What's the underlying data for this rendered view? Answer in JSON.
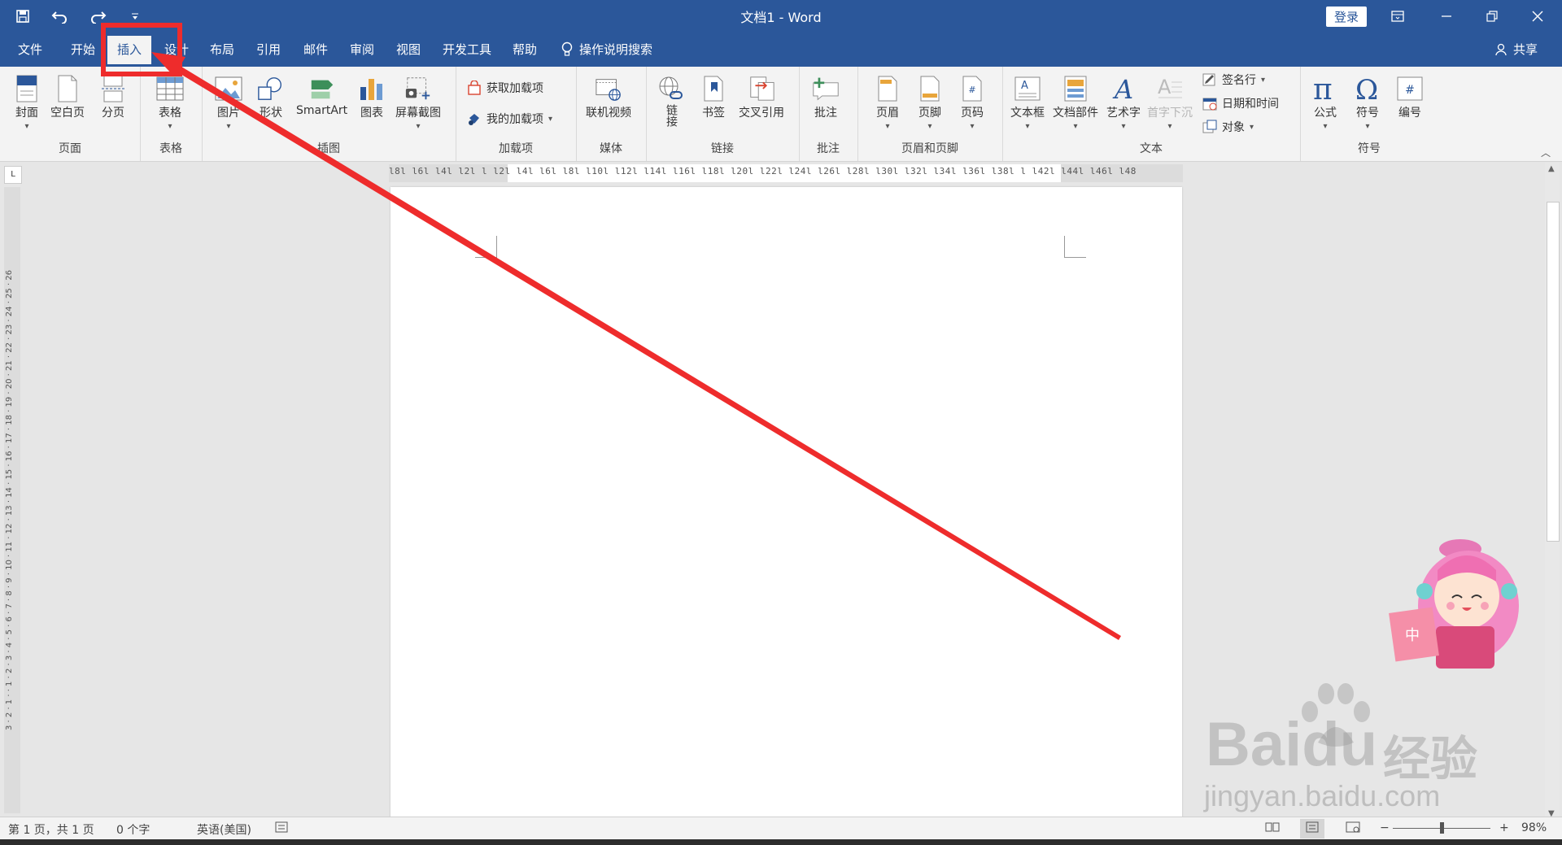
{
  "titlebar": {
    "title": "文档1  -  Word",
    "login": "登录"
  },
  "tabs": [
    "文件",
    "开始",
    "插入",
    "设计",
    "布局",
    "引用",
    "邮件",
    "审阅",
    "视图",
    "开发工具",
    "帮助"
  ],
  "active_tab": "插入",
  "tellme": "操作说明搜索",
  "share": "共享",
  "ribbon": {
    "pages": {
      "cover": "封面",
      "blank": "空白页",
      "break": "分页",
      "label": "页面"
    },
    "tables": {
      "table": "表格",
      "label": "表格"
    },
    "illustrations": {
      "picture": "图片",
      "shapes": "形状",
      "smartart": "SmartArt",
      "chart": "图表",
      "screenshot": "屏幕截图",
      "label": "插图"
    },
    "addins": {
      "get": "获取加载项",
      "mine": "我的加载项",
      "label": "加载项"
    },
    "media": {
      "video": "联机视频",
      "label": "媒体"
    },
    "links": {
      "link": "链接",
      "bookmark": "书签",
      "crossref": "交叉引用",
      "label": "链接"
    },
    "comments": {
      "comment": "批注",
      "label": "批注"
    },
    "headerfooter": {
      "header": "页眉",
      "footer": "页脚",
      "pagenum": "页码",
      "label": "页眉和页脚"
    },
    "text": {
      "textbox": "文本框",
      "parts": "文档部件",
      "wordart": "艺术字",
      "dropcap": "首字下沉",
      "signature": "签名行",
      "datetime": "日期和时间",
      "object": "对象",
      "label": "文本"
    },
    "symbols": {
      "equation": "公式",
      "symbol": "符号",
      "number": "编号",
      "label": "符号"
    }
  },
  "ruler": {
    "h": "l8l  l6l  l4l  l2l   l   l2l  l4l  l6l  l8l  l10l  l12l  l14l  l16l  l18l  l20l  l22l  l24l  l26l  l28l  l30l  l32l  l34l  l36l  l38l    l  l42l  l44l  l46l  l48",
    "v": "3 · 2 · 1 ·   · 1 · 2 · 3 · 4 · 5 · 6 · 7 · 8 · 9 · 10 · 11 · 12 · 13 · 14 · 15 · 16 · 17 · 18 · 19 · 20 · 21 · 22 · 23 · 24 · 25 · 26"
  },
  "status": {
    "page": "第 1 页，共 1 页",
    "words": "0 个字",
    "lang": "英语(美国)",
    "zoom": "98%",
    "minus": "−",
    "plus": "+"
  },
  "watermark": {
    "bai": "Bai",
    "du": "du",
    "cn": "经验",
    "url": "jingyan.baidu.com"
  },
  "mascot_sign": "中",
  "colors": {
    "word_blue": "#2b579a",
    "annotation_red": "#ee2c2c"
  }
}
